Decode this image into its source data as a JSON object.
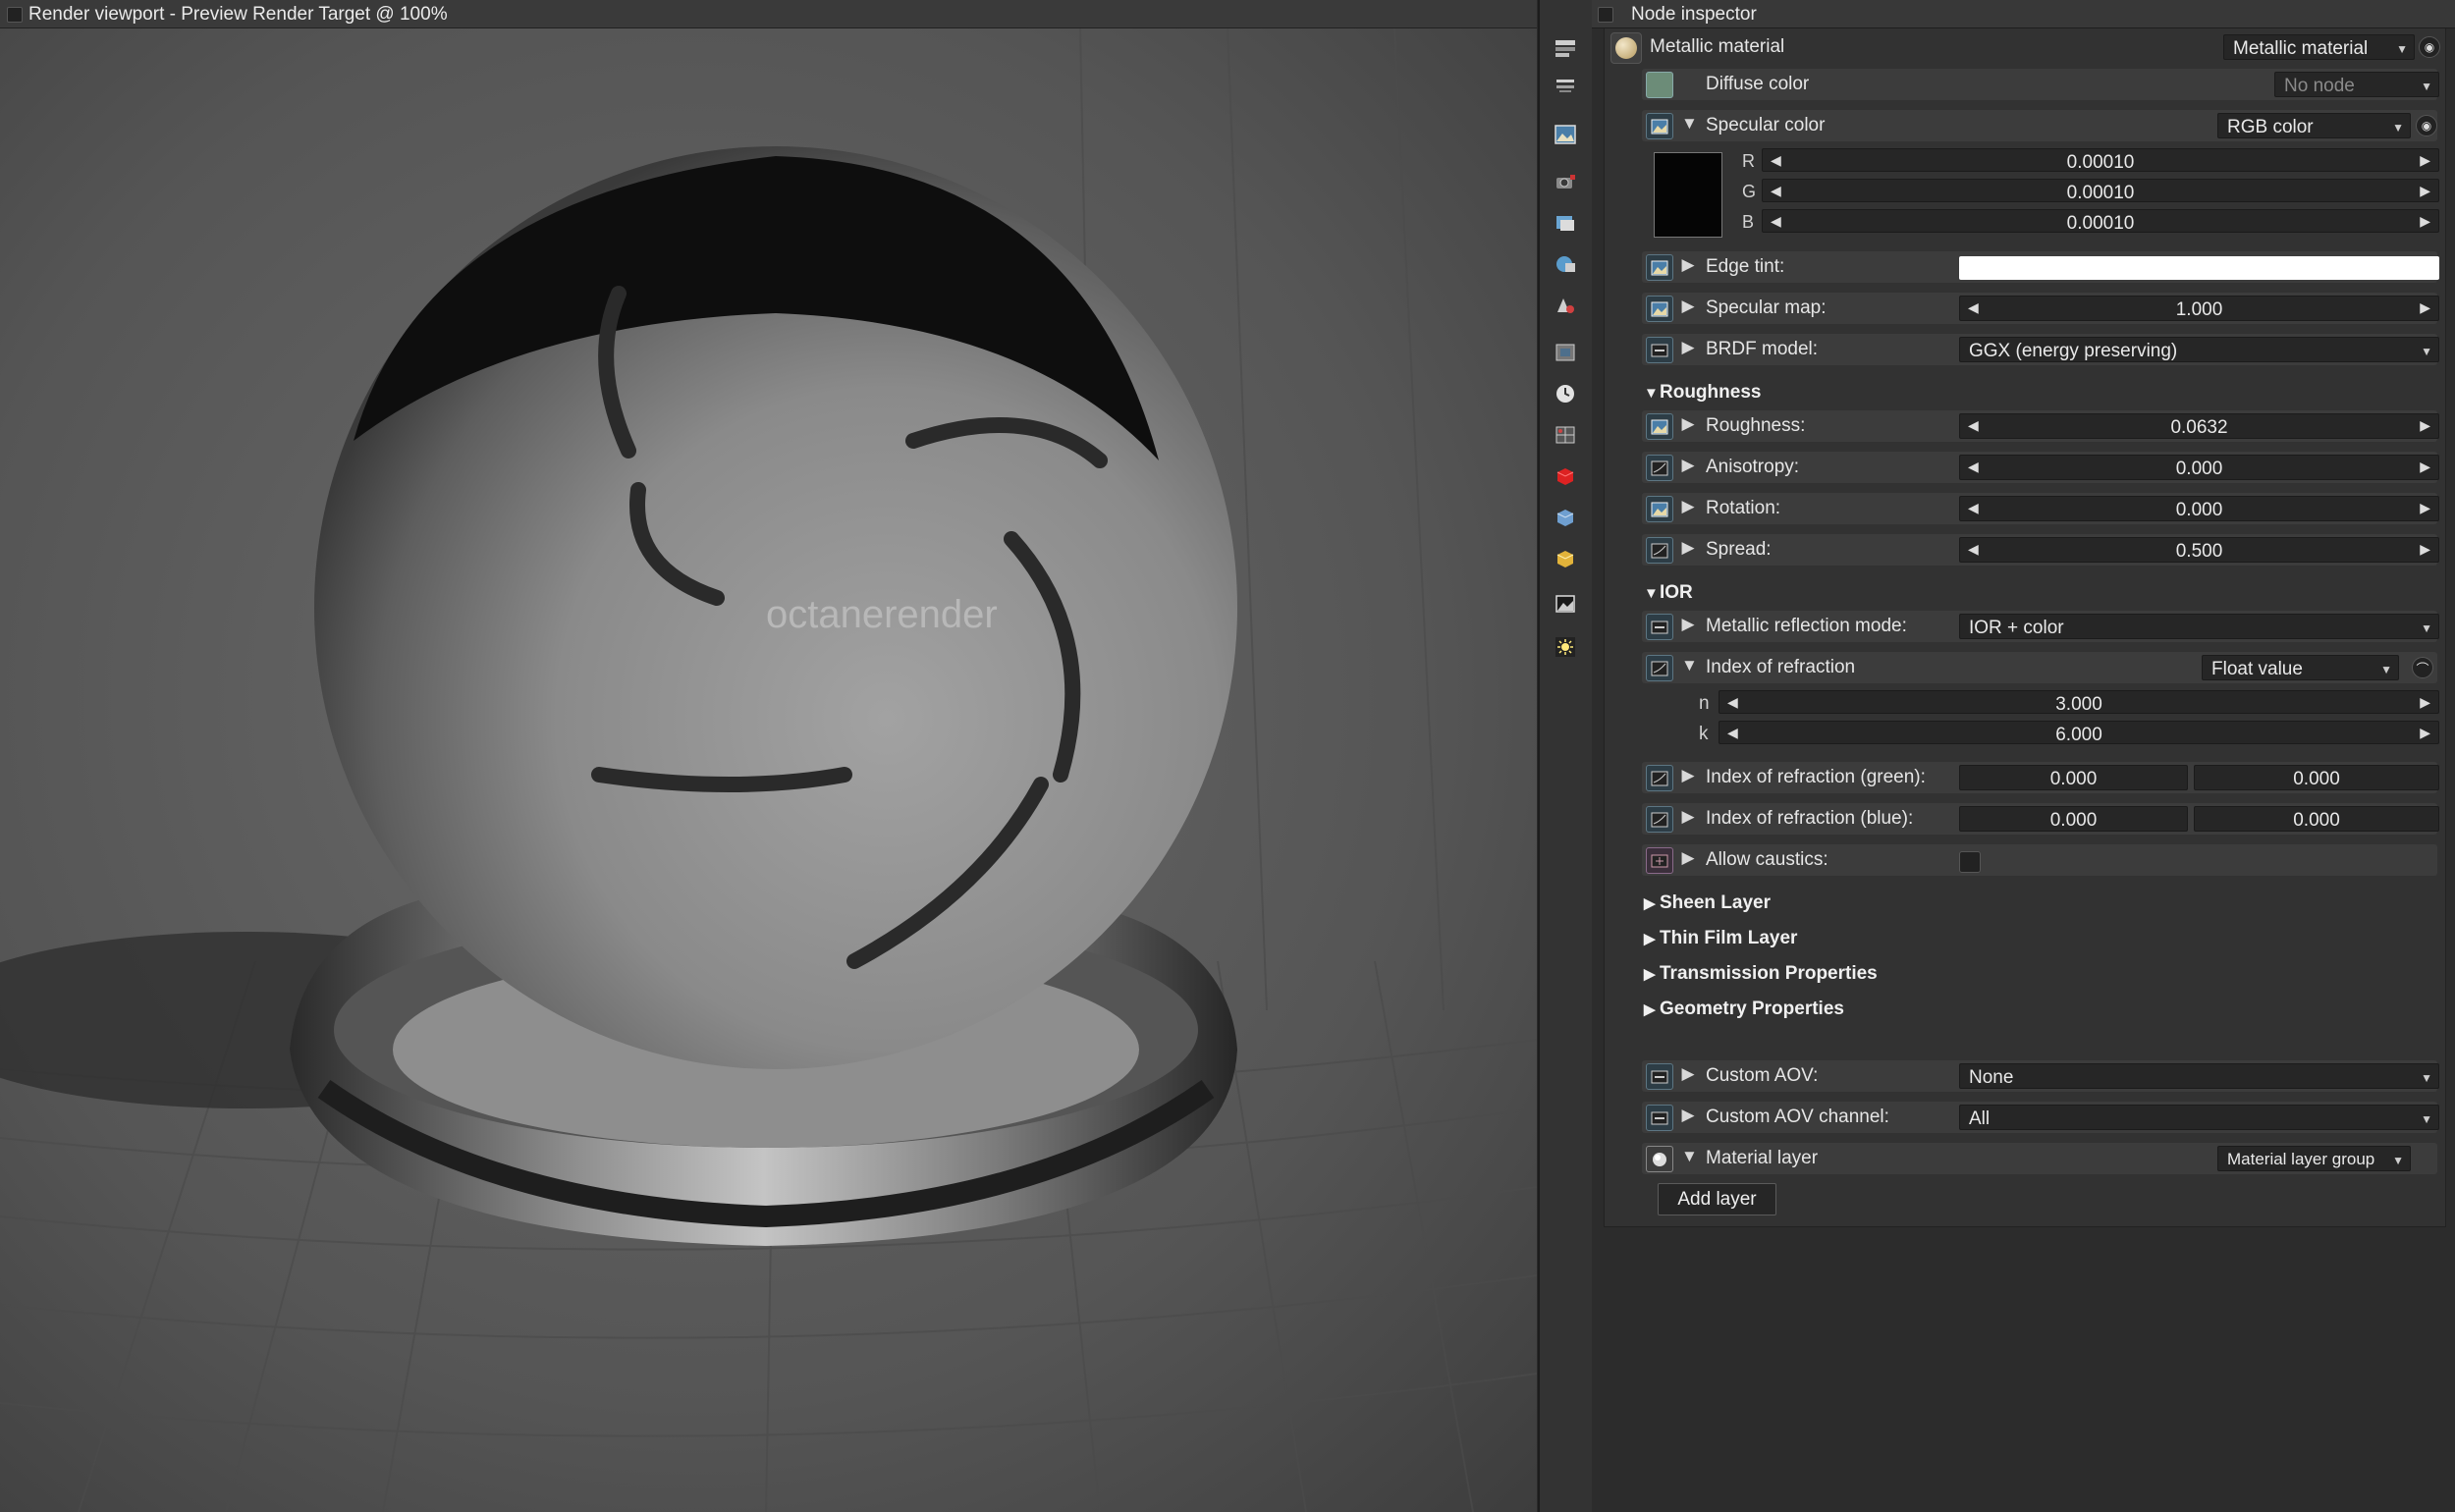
{
  "viewport": {
    "title": "Render viewport - Preview Render Target @ 100%",
    "logo_text": "octanerender"
  },
  "inspector": {
    "title": "Node inspector",
    "node_name": "Metallic material",
    "node_type_dropdown": "Metallic material",
    "diffuse": {
      "label": "Diffuse color",
      "value": "No node"
    },
    "specular": {
      "label": "Specular color",
      "type": "RGB color",
      "swatch_color": "#050505",
      "channels": [
        {
          "name": "R",
          "value": "0.00010"
        },
        {
          "name": "G",
          "value": "0.00010"
        },
        {
          "name": "B",
          "value": "0.00010"
        }
      ]
    },
    "edge_tint": {
      "label": "Edge tint:",
      "swatch_color": "#ffffff"
    },
    "specular_map": {
      "label": "Specular map:",
      "value": "1.000"
    },
    "brdf": {
      "label": "BRDF model:",
      "value": "GGX (energy preserving)"
    },
    "roughness_section": {
      "title": "Roughness",
      "rows": [
        {
          "label": "Roughness:",
          "value": "0.0632"
        },
        {
          "label": "Anisotropy:",
          "value": "0.000"
        },
        {
          "label": "Rotation:",
          "value": "0.000"
        },
        {
          "label": "Spread:",
          "value": "0.500"
        }
      ]
    },
    "ior_section": {
      "title": "IOR",
      "reflection_mode": {
        "label": "Metallic reflection mode:",
        "value": "IOR + color"
      },
      "index": {
        "label": "Index of refraction",
        "type": "Float value",
        "n": {
          "name": "n",
          "value": "3.000"
        },
        "k": {
          "name": "k",
          "value": "6.000"
        }
      },
      "green": {
        "label": "Index of refraction (green):",
        "v1": "0.000",
        "v2": "0.000"
      },
      "blue": {
        "label": "Index of refraction (blue):",
        "v1": "0.000",
        "v2": "0.000"
      },
      "caustics": {
        "label": "Allow caustics:",
        "checked": false
      }
    },
    "collapsed_sections": [
      "Sheen Layer",
      "Thin Film Layer",
      "Transmission Properties",
      "Geometry Properties"
    ],
    "custom_aov": {
      "label": "Custom AOV:",
      "value": "None"
    },
    "custom_aov_channel": {
      "label": "Custom AOV channel:",
      "value": "All"
    },
    "material_layer": {
      "label": "Material layer",
      "type": "Material layer group",
      "button": "Add layer"
    }
  },
  "colors": {
    "panel_bg": "#323232",
    "row_bg": "#3c3c3c",
    "field_bg": "#262626",
    "pin_blue": "#5d7683"
  },
  "sidebar_icons": [
    "layers-icon",
    "list-icon",
    "image-icon",
    "camera-icon",
    "render-target-icon",
    "environment-icon",
    "geometry-icon",
    "texture-icon",
    "clock-icon",
    "material-grid-icon",
    "red-cube-icon",
    "blue-cube-icon",
    "yellow-cube-icon",
    "picture-icon",
    "light-icon"
  ]
}
